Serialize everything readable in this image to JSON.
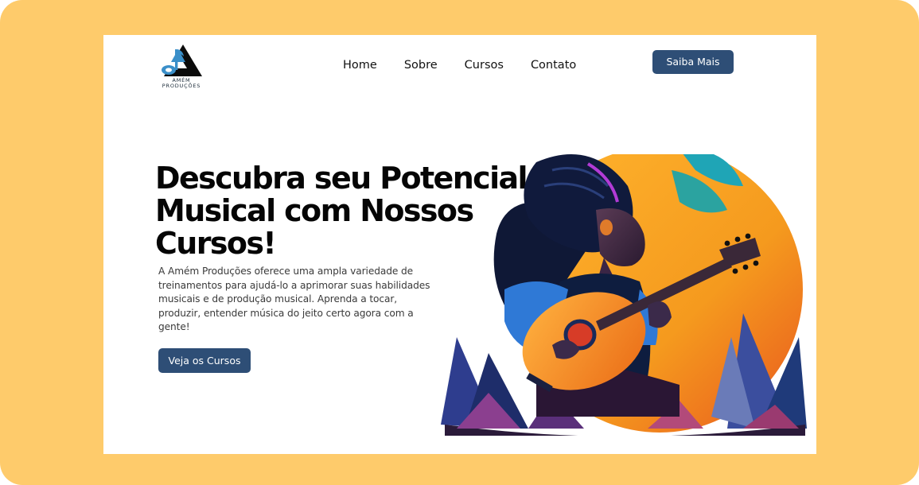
{
  "brand": {
    "logo_line1": "AMÉM",
    "logo_line2": "PRODUÇÕES",
    "logo_icon": "music-note-mountain-logo"
  },
  "nav": {
    "items": [
      {
        "label": "Home"
      },
      {
        "label": "Sobre"
      },
      {
        "label": "Cursos"
      },
      {
        "label": "Contato"
      }
    ],
    "cta_label": "Saiba Mais"
  },
  "hero": {
    "title": "Descubra seu Potencial Musical com Nossos Cursos!",
    "description": "A Amém Produções oferece uma ampla variedade de treinamentos para ajudá-lo a aprimorar suas habilidades musicais e de produção musical. Aprenda a tocar, produzir, entender música do jeito certo agora com a gente!",
    "cta_label": "Veja os Cursos",
    "illustration": "woman-playing-guitar-illustration"
  },
  "colors": {
    "frame_background": "#FECB6B",
    "button": "#2E4E76",
    "sun_orange": "#F59A1E"
  }
}
